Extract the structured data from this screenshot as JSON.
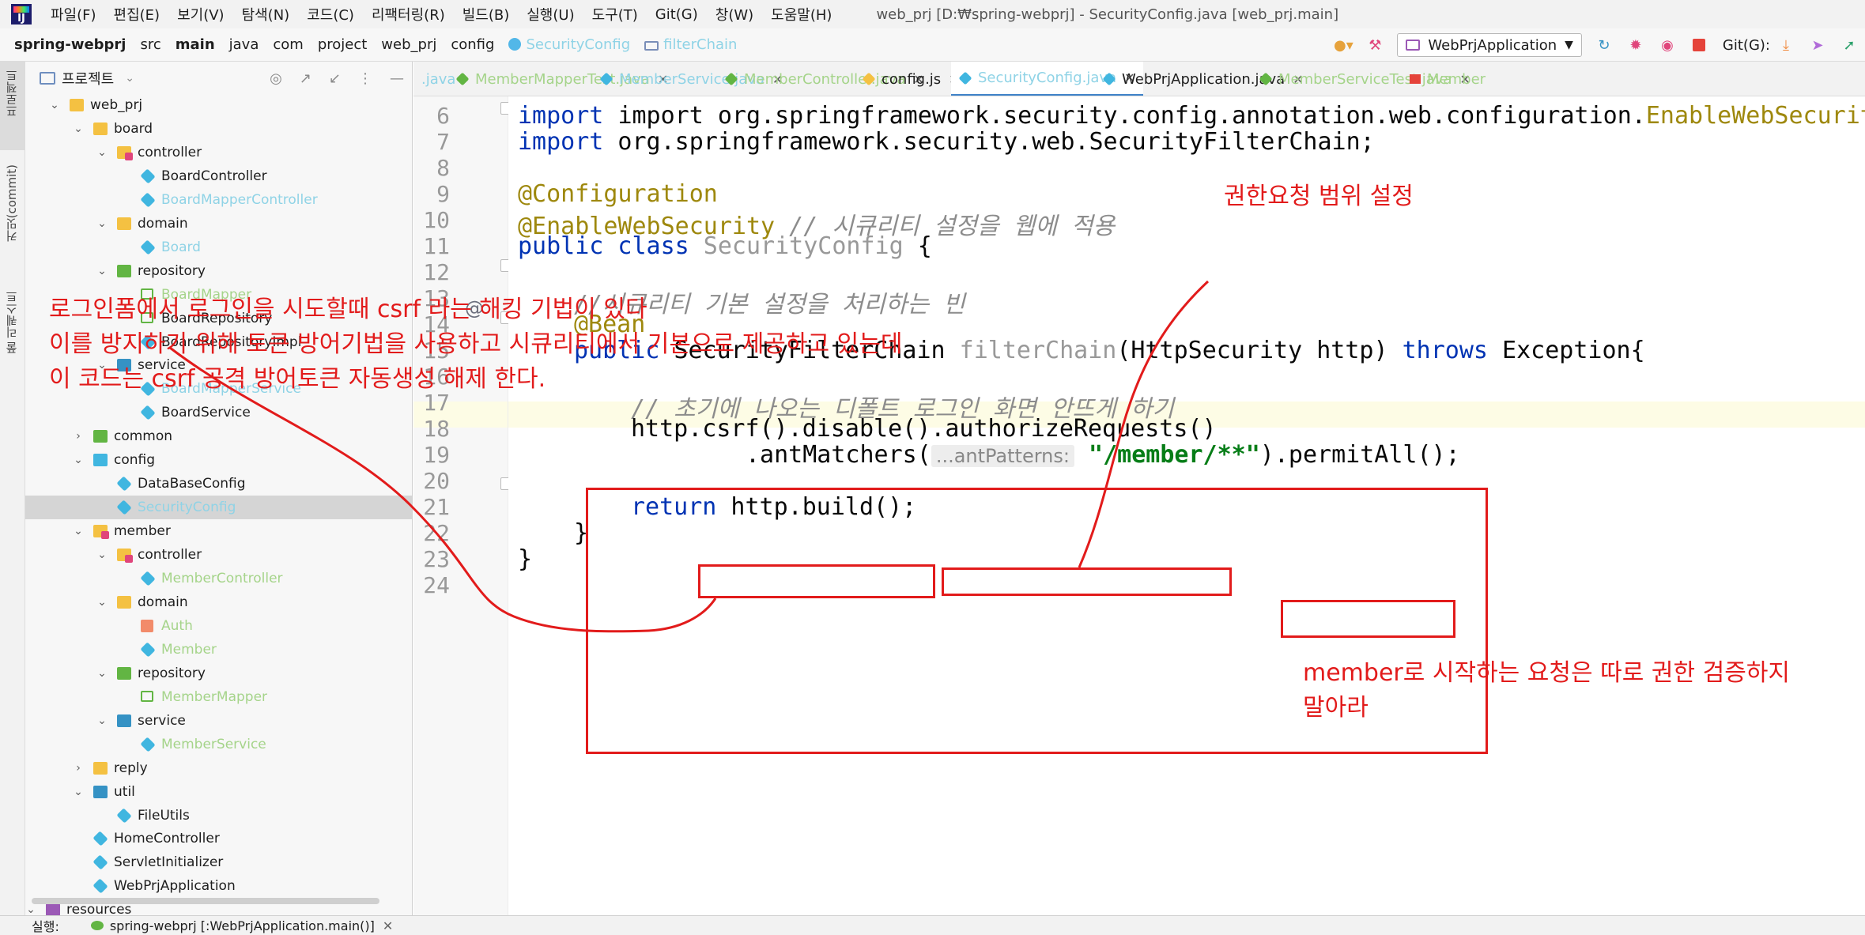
{
  "menubar": {
    "items": [
      "파일(F)",
      "편집(E)",
      "보기(V)",
      "탐색(N)",
      "코드(C)",
      "리팩터링(R)",
      "빌드(B)",
      "실행(U)",
      "도구(T)",
      "Git(G)",
      "창(W)",
      "도움말(H)"
    ],
    "window_title": "web_prj [D:₩spring-webprj] - SecurityConfig.java [web_prj.main]"
  },
  "navbar": {
    "crumbs": [
      "spring-webprj",
      "src",
      "main",
      "java",
      "com",
      "project",
      "web_prj",
      "config",
      "SecurityConfig",
      "filterChain"
    ],
    "run_config": "WebPrjApplication",
    "git_label": "Git(G):"
  },
  "left_strip": {
    "tabs": [
      "프로젝트",
      "커밋(commit)",
      "풀 리퀘스트"
    ]
  },
  "project_panel": {
    "title": "프로젝트",
    "tree": [
      {
        "label": "web_prj",
        "icon": "folder",
        "style": "normal"
      },
      {
        "label": "board",
        "icon": "folder",
        "style": "normal"
      },
      {
        "label": "controller",
        "icon": "pkg-red",
        "style": "normal"
      },
      {
        "label": "BoardController",
        "icon": "class",
        "style": "normal"
      },
      {
        "label": "BoardMapperController",
        "icon": "class",
        "style": "dim"
      },
      {
        "label": "domain",
        "icon": "folder",
        "style": "normal"
      },
      {
        "label": "Board",
        "icon": "class",
        "style": "dim"
      },
      {
        "label": "repository",
        "icon": "pkg-green",
        "style": "normal"
      },
      {
        "label": "BoardMapper",
        "icon": "mapper",
        "style": "dim-green"
      },
      {
        "label": "BoardRepository",
        "icon": "mapper",
        "style": "normal"
      },
      {
        "label": "BoardRepositoryImpl",
        "icon": "class",
        "style": "normal"
      },
      {
        "label": "service",
        "icon": "pkg-blue",
        "style": "normal"
      },
      {
        "label": "BoardMapperService",
        "icon": "class",
        "style": "dim"
      },
      {
        "label": "BoardService",
        "icon": "class",
        "style": "normal"
      },
      {
        "label": "common",
        "icon": "pkg-green",
        "style": "normal"
      },
      {
        "label": "config",
        "icon": "pkg-teal",
        "style": "normal"
      },
      {
        "label": "DataBaseConfig",
        "icon": "class",
        "style": "normal"
      },
      {
        "label": "SecurityConfig",
        "icon": "class",
        "style": "dim"
      },
      {
        "label": "member",
        "icon": "pkg-red",
        "style": "normal"
      },
      {
        "label": "controller",
        "icon": "pkg-red",
        "style": "normal"
      },
      {
        "label": "MemberController",
        "icon": "class",
        "style": "dim-green"
      },
      {
        "label": "domain",
        "icon": "folder",
        "style": "normal"
      },
      {
        "label": "Auth",
        "icon": "auth",
        "style": "dim-green"
      },
      {
        "label": "Member",
        "icon": "class",
        "style": "dim-green"
      },
      {
        "label": "repository",
        "icon": "pkg-green",
        "style": "normal"
      },
      {
        "label": "MemberMapper",
        "icon": "mapper",
        "style": "dim-green"
      },
      {
        "label": "service",
        "icon": "pkg-blue",
        "style": "normal"
      },
      {
        "label": "MemberService",
        "icon": "class",
        "style": "dim-green"
      },
      {
        "label": "reply",
        "icon": "folder",
        "style": "normal"
      },
      {
        "label": "util",
        "icon": "pkg-blue",
        "style": "normal"
      },
      {
        "label": "FileUtils",
        "icon": "class",
        "style": "normal"
      },
      {
        "label": "HomeController",
        "icon": "class",
        "style": "normal"
      },
      {
        "label": "ServletInitializer",
        "icon": "class",
        "style": "normal"
      },
      {
        "label": "WebPrjApplication",
        "icon": "class",
        "style": "normal"
      },
      {
        "label": "resources",
        "icon": "resources",
        "style": "normal"
      }
    ]
  },
  "editor_tabs": [
    {
      "label": ".java",
      "style": "faded-blue"
    },
    {
      "label": "MemberMapperTest.java",
      "style": "faded"
    },
    {
      "label": "MemberService.java",
      "style": "faded-blue"
    },
    {
      "label": "MemberController.java",
      "style": "faded"
    },
    {
      "label": "config.js",
      "style": "normal"
    },
    {
      "label": "SecurityConfig.java",
      "style": "faded-blue"
    },
    {
      "label": "WebPrjApplication.java",
      "style": "normal"
    },
    {
      "label": "MemberServiceTest.java",
      "style": "faded"
    },
    {
      "label": "Member",
      "style": "faded"
    }
  ],
  "code": {
    "line_numbers": [
      "6",
      "7",
      "8",
      "9",
      "10",
      "11",
      "12",
      "13",
      "14",
      "15",
      "16",
      "17",
      "18",
      "19",
      "20",
      "21",
      "22",
      "23",
      "24"
    ],
    "l6_a": "import org.springframework.security.config.annotation.web.configuration.",
    "l6_b": "EnableWebSecurity",
    "l6_c": ";",
    "l7_kw": "import",
    "l7_rest": " org.springframework.security.web.SecurityFilterChain;",
    "l9": "@Configuration",
    "l10_ann": "@EnableWebSecurity",
    "l10_cmt": " // 시큐리티 설정을 웹에 적용",
    "l11_kw": "public class",
    "l11_name": " SecurityConfig",
    "l11_brace": " {",
    "l13_cmt": "//시큐리티 기본 설정을 처리하는 빈",
    "l14_ann": "@Bean",
    "l15_kw": "public",
    "l15_type": " SecurityFilterChain ",
    "l15_fn": "filterChain",
    "l15_params": "(HttpSecurity http) ",
    "l15_throws": "throws",
    "l15_exc": " Exception{",
    "l17_cmt": "// 초기에 나오는 디폴트 로그인 화면 안뜨게 하기",
    "l18": "http.csrf().disable().authorizeRequests()",
    "l19_a": ".antMatchers(",
    "l19_hint": "...antPatterns:",
    "l19_str": "\"/member/**\"",
    "l19_b": ").permitAll();",
    "l21_kw": "return",
    "l21_rest": " http.build();",
    "l22": "}",
    "l23": "}"
  },
  "annotations": {
    "scope_note": "권한요청 범위 설정",
    "csrf_note_1": "로그인폼에서 로그인을 시도할때 csrf 라는 해킹 기법이 있다",
    "csrf_note_2": "이를 방지하기 위해 토큰 방어기법을 사용하고 시큐리티에서 기본으로 제공하고 있는데",
    "csrf_note_3": "이 코드는 csrf 공격 방어토큰 자동생성 해제 한다.",
    "member_note_1": "member로 시작하는 요청은 따로 권한 검증하지",
    "member_note_2": "말아라",
    "color": "#e21b1b"
  },
  "bottombar": {
    "label": "실행:",
    "run_target": "spring-webprj [:WebPrjApplication.main()]"
  }
}
